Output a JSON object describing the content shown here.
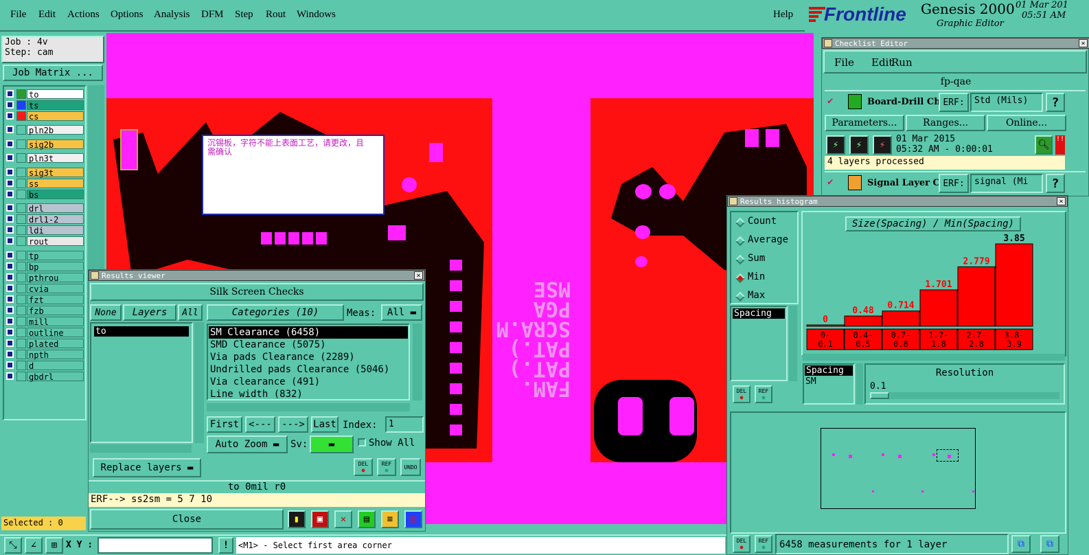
{
  "menu": {
    "items": [
      "File",
      "Edit",
      "Actions",
      "Options",
      "Analysis",
      "DFM",
      "Step",
      "Rout",
      "Windows"
    ],
    "help": "Help"
  },
  "brand": {
    "logo_text": "Frontline",
    "product": "Genesis 2000",
    "subtitle": "Graphic Editor",
    "date": "01 Mar 201",
    "time": "05:51 AM"
  },
  "job_panel": {
    "job": "Job : 4v",
    "step": "Step: cam",
    "matrix_button": "Job Matrix ...",
    "selected": "Selected : 0"
  },
  "layers": [
    {
      "name": "to",
      "color": "#ffffff",
      "swatch": "#2e9a2e",
      "check": "#16208a"
    },
    {
      "name": "ts",
      "color": "#1fa37c",
      "swatch": "#1f40ff",
      "check": "#16208a"
    },
    {
      "name": "cs",
      "color": "#f7c244",
      "swatch": "#ff1a1a",
      "check": "#16208a"
    },
    {
      "name": "pln2b",
      "color": "#f0f0f0",
      "swatch": "#5cc7ab",
      "check": "#16208a"
    },
    {
      "name": "sig2b",
      "color": "#f7c244",
      "swatch": "#5cc7ab",
      "check": "#16208a"
    },
    {
      "name": "pln3t",
      "color": "#f0f0f0",
      "swatch": "#5cc7ab",
      "check": "#16208a"
    },
    {
      "name": "sig3t",
      "color": "#f7c244",
      "swatch": "#5cc7ab",
      "check": "#16208a"
    },
    {
      "name": "ss",
      "color": "#f7c244",
      "swatch": "#5cc7ab",
      "check": "#16208a"
    },
    {
      "name": "bs",
      "color": "#1fa37c",
      "swatch": "#5cc7ab",
      "check": "#16208a"
    },
    {
      "name": "drl",
      "color": "#b7c4d0",
      "swatch": "#5cc7ab",
      "check": "#16208a"
    },
    {
      "name": "drl1-2",
      "color": "#b7c4d0",
      "swatch": "#5cc7ab",
      "check": "#16208a"
    },
    {
      "name": "ldi",
      "color": "#b7c4d0",
      "swatch": "#5cc7ab",
      "check": "#16208a"
    },
    {
      "name": "rout",
      "color": "#e8e8e8",
      "swatch": "#5cc7ab",
      "check": "#16208a"
    },
    {
      "name": "tp",
      "color": "#5cc7ab",
      "swatch": "#5cc7ab",
      "check": "#16208a"
    },
    {
      "name": "bp",
      "color": "#5cc7ab",
      "swatch": "#5cc7ab",
      "check": "#16208a"
    },
    {
      "name": "pthrou",
      "color": "#5cc7ab",
      "swatch": "#5cc7ab",
      "check": "#16208a"
    },
    {
      "name": "cvia",
      "color": "#5cc7ab",
      "swatch": "#5cc7ab",
      "check": "#16208a"
    },
    {
      "name": "fzt",
      "color": "#5cc7ab",
      "swatch": "#5cc7ab",
      "check": "#16208a"
    },
    {
      "name": "fzb",
      "color": "#5cc7ab",
      "swatch": "#5cc7ab",
      "check": "#16208a"
    },
    {
      "name": "mill",
      "color": "#5cc7ab",
      "swatch": "#5cc7ab",
      "check": "#16208a"
    },
    {
      "name": "outline",
      "color": "#5cc7ab",
      "swatch": "#5cc7ab",
      "check": "#16208a"
    },
    {
      "name": "plated",
      "color": "#5cc7ab",
      "swatch": "#5cc7ab",
      "check": "#16208a"
    },
    {
      "name": "npth",
      "color": "#5cc7ab",
      "swatch": "#5cc7ab",
      "check": "#16208a"
    },
    {
      "name": "d",
      "color": "#5cc7ab",
      "swatch": "#5cc7ab",
      "check": "#16208a"
    },
    {
      "name": "gbdrl",
      "color": "#5cc7ab",
      "swatch": "#5cc7ab",
      "check": "#16208a"
    }
  ],
  "canvas": {
    "note_text": "沉锡板，字符不能上表面工艺，请更改，且需确认",
    "silk_text": [
      "FAM.",
      "PAT.)",
      "PAT.)",
      "SCRA.M",
      "PGA",
      "MSE"
    ]
  },
  "status_bar": {
    "xy_label": "X Y :",
    "prompt": "<M1> - Select first area corner"
  },
  "checklist_editor": {
    "title": "Checklist Editor",
    "menu": [
      "File",
      "Edit",
      "Run"
    ],
    "name": "fp-qae",
    "row1": {
      "label": "Board-Drill Che",
      "erf_label": "ERF:",
      "erf_value": "Std (Mils)",
      "help": "?"
    },
    "buttons": [
      "Parameters...",
      "Ranges...",
      "Online..."
    ],
    "date": "01 Mar 2015",
    "time": "05:32 AM - 0:00:01",
    "processed": "4 layers processed",
    "row2": {
      "label": "Signal Layer Ch",
      "erf_label": "ERF:",
      "erf_value": "signal (Mi",
      "help": "?"
    },
    "alert": "!!"
  },
  "results_viewer": {
    "title": "Results viewer",
    "header": "Silk Screen Checks",
    "none": "None",
    "layers": "Layers",
    "all": "All",
    "layer_list": [
      "to"
    ],
    "categories_label": "Categories (10)",
    "meas_label": "Meas:",
    "meas_value": "All",
    "categories": [
      "SM Clearance (6458)",
      "SMD Clearance (5075)",
      "Via pads Clearance (2289)",
      "Undrilled pads Clearance (5046)",
      "Via clearance (491)",
      "Line width (832)"
    ],
    "nav": {
      "first": "First",
      "prev": "<---",
      "next": "--->",
      "last": "Last",
      "index_label": "Index:",
      "index_value": "1"
    },
    "auto_zoom": "Auto Zoom",
    "sv_label": "Sv:",
    "show_all": "Show All",
    "replace_layers": "Replace layers",
    "del": "DEL",
    "ref": "REF",
    "undo": "UNDO",
    "info": "to 0mil   r0",
    "erf_line": "ERF--> ss2sm = 5 7 10",
    "close": "Close"
  },
  "histogram": {
    "title": "Results histogram",
    "modes": [
      "Count",
      "Average",
      "Sum",
      "Min",
      "Max"
    ],
    "selected_mode": "Min",
    "list1": [
      "Spacing"
    ],
    "list2": [
      "Spacing",
      "SM"
    ],
    "heading": "Size(Spacing) / Min(Spacing)",
    "resolution_label": "Resolution",
    "resolution_value": "0.1",
    "del": "DEL",
    "ref": "REF",
    "status": "6458 measurements for 1 layer",
    "accent": "#ff0000"
  },
  "chart_data": {
    "type": "bar",
    "title": "Size(Spacing) / Min(Spacing)",
    "categories": [
      "0-\n0.1",
      "0.4-\n0.5",
      "0.7-\n0.8",
      "1.7-\n1.8",
      "2.7-\n2.8",
      "3.8-\n3.9"
    ],
    "values": [
      0,
      0.48,
      0.714,
      1.701,
      2.779,
      3.85
    ],
    "value_labels": [
      "0",
      "0.48",
      "0.714",
      "1.701",
      "2.779",
      "3.85"
    ],
    "ylim": [
      0,
      3.85
    ],
    "grid": false
  }
}
